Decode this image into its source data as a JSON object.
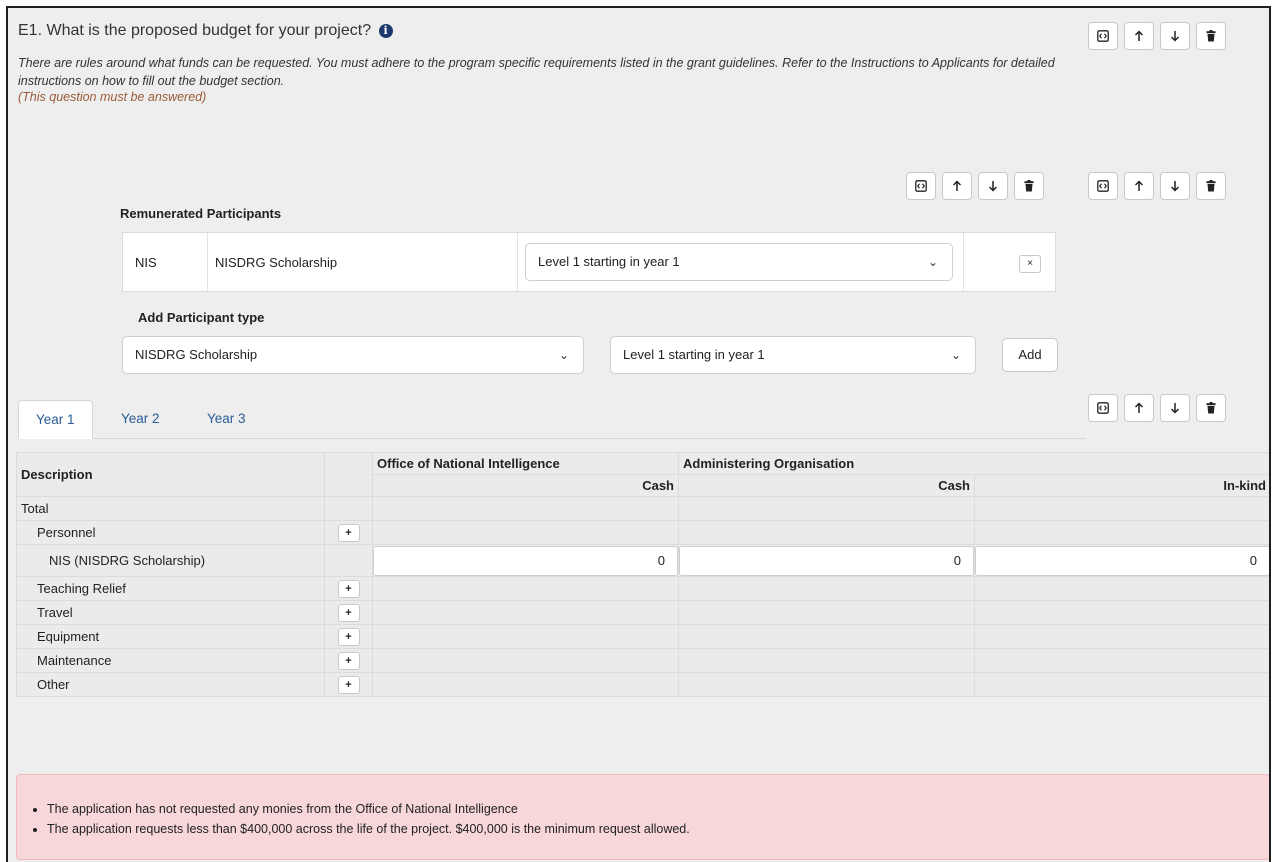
{
  "question": {
    "title": "E1. What is the proposed budget for your project?",
    "description": "There are rules around what funds can be requested. You must adhere to the program specific requirements listed in the grant guidelines. Refer to the Instructions to Applicants for detailed instructions on how to fill out the budget section.",
    "required_note": "(This question must be answered)"
  },
  "remunerated": {
    "label": "Remunerated Participants",
    "row": {
      "code": "NIS",
      "name": "NISDRG Scholarship",
      "level": "Level 1 starting in year 1",
      "remove_label": "×"
    }
  },
  "add_participant": {
    "label": "Add Participant type",
    "type_value": "NISDRG Scholarship",
    "level_value": "Level 1 starting in year 1",
    "add_label": "Add"
  },
  "tabs": [
    "Year 1",
    "Year 2",
    "Year 3"
  ],
  "budget_table": {
    "col_description": "Description",
    "group_oni": "Office of National Intelligence",
    "group_admin": "Administering Organisation",
    "cash": "Cash",
    "inkind": "In-kind",
    "rows": {
      "total": "Total",
      "personnel": "Personnel",
      "nis": "NIS (NISDRG Scholarship)",
      "teaching": "Teaching Relief",
      "travel": "Travel",
      "equipment": "Equipment",
      "maintenance": "Maintenance",
      "other": "Other"
    },
    "nis_values": {
      "oni_cash": "0",
      "admin_cash": "0",
      "admin_inkind": "0"
    },
    "plus_label": "+"
  },
  "alerts": [
    "The application has not requested any monies from the Office of National Intelligence",
    "The application requests less than $400,000 across the life of the project. $400,000 is the minimum request allowed."
  ],
  "icons": {
    "info": "info-icon",
    "code": "code-icon",
    "up": "arrow-up-icon",
    "down": "arrow-down-icon",
    "delete": "trash-icon",
    "chevron": "chevron-down-icon"
  },
  "colors": {
    "background": "#eeeeee",
    "link": "#2a5c93",
    "alert_bg": "#f8d7da",
    "required": "#9a5a3a"
  }
}
